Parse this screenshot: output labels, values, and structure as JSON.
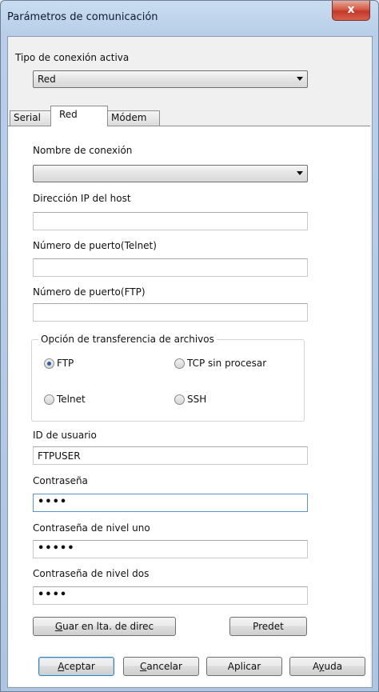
{
  "window": {
    "title": "Parámetros de comunicación",
    "close_label": "x"
  },
  "connection_type": {
    "label": "Tipo de conexión activa",
    "value": "Red"
  },
  "tabs": [
    {
      "label": "Serial"
    },
    {
      "label": "Red"
    },
    {
      "label": "Módem"
    }
  ],
  "active_tab": "Red",
  "network": {
    "connection_name": {
      "label": "Nombre de conexión",
      "value": ""
    },
    "host_ip": {
      "label": "Dirección IP del host",
      "value": ""
    },
    "telnet_port": {
      "label": "Número de puerto(Telnet)",
      "value": ""
    },
    "ftp_port": {
      "label": "Número de puerto(FTP)",
      "value": ""
    },
    "transfer_option": {
      "title": "Opción de transferencia de archivos",
      "options": [
        {
          "label": "FTP",
          "selected": true
        },
        {
          "label": "TCP sin procesar",
          "selected": false
        },
        {
          "label": "Telnet",
          "selected": false
        },
        {
          "label": "SSH",
          "selected": false
        }
      ]
    },
    "user_id": {
      "label": "ID de usuario",
      "value": "FTPUSER"
    },
    "password": {
      "label": "Contraseña",
      "value": "••••"
    },
    "level1_password": {
      "label": "Contraseña de nivel uno",
      "value": "•••••"
    },
    "level2_password": {
      "label": "Contraseña de nivel dos",
      "value": "••••"
    },
    "save_button": {
      "mnemonic": "G",
      "rest": "uar en lta. de direc"
    },
    "defaults_button": "Predet"
  },
  "footer": {
    "ok": {
      "mnemonic": "A",
      "rest": "ceptar"
    },
    "cancel": {
      "mnemonic": "C",
      "rest": "ancelar"
    },
    "apply": "Aplicar",
    "help": {
      "pre": "A",
      "mnemonic": "y",
      "rest": "uda"
    }
  }
}
